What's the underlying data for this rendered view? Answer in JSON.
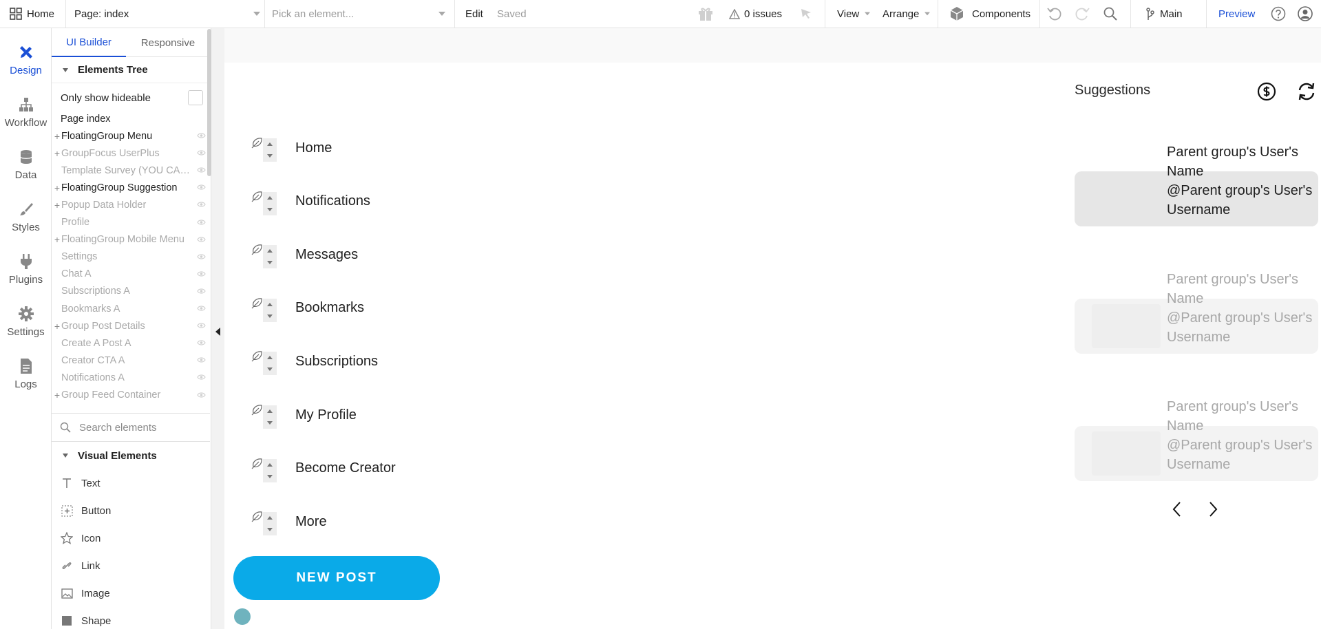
{
  "topbar": {
    "home_label": "Home",
    "page_label": "Page: index",
    "element_placeholder": "Pick an element...",
    "edit_label": "Edit",
    "saved_label": "Saved",
    "issues_label": "0 issues",
    "view_label": "View",
    "arrange_label": "Arrange",
    "components_label": "Components",
    "branch_label": "Main",
    "preview_label": "Preview"
  },
  "rail": {
    "items": [
      {
        "label": "Design",
        "icon": "design-icon"
      },
      {
        "label": "Workflow",
        "icon": "workflow-icon"
      },
      {
        "label": "Data",
        "icon": "database-icon"
      },
      {
        "label": "Styles",
        "icon": "brush-icon"
      },
      {
        "label": "Plugins",
        "icon": "plug-icon"
      },
      {
        "label": "Settings",
        "icon": "gear-icon"
      },
      {
        "label": "Logs",
        "icon": "document-icon"
      }
    ]
  },
  "panel": {
    "tabs": [
      "UI Builder",
      "Responsive"
    ],
    "tree_title": "Elements Tree",
    "only_hideable_label": "Only show hideable",
    "page_row": "Page index",
    "tree_items": [
      {
        "label": "FloatingGroup Menu",
        "plus": "+",
        "dim": false
      },
      {
        "label": "GroupFocus UserPlus",
        "plus": "+",
        "dim": true
      },
      {
        "label": "Template Survey (YOU CAN...",
        "plus": "",
        "dim": true
      },
      {
        "label": "FloatingGroup Suggestion",
        "plus": "+",
        "dim": false
      },
      {
        "label": "Popup Data Holder",
        "plus": "+",
        "dim": true
      },
      {
        "label": "Profile",
        "plus": "",
        "dim": true
      },
      {
        "label": "FloatingGroup Mobile Menu",
        "plus": "+",
        "dim": true
      },
      {
        "label": "Settings",
        "plus": "",
        "dim": true
      },
      {
        "label": "Chat A",
        "plus": "",
        "dim": true
      },
      {
        "label": "Subscriptions A",
        "plus": "",
        "dim": true
      },
      {
        "label": "Bookmarks A",
        "plus": "",
        "dim": true
      },
      {
        "label": "Group Post Details",
        "plus": "+",
        "dim": true
      },
      {
        "label": "Create A Post A",
        "plus": "",
        "dim": true
      },
      {
        "label": "Creator CTA A",
        "plus": "",
        "dim": true
      },
      {
        "label": "Notifications A",
        "plus": "",
        "dim": true
      },
      {
        "label": "Group Feed Container",
        "plus": "+",
        "dim": true
      }
    ],
    "search_placeholder": "Search elements",
    "visual_title": "Visual Elements",
    "visual_items": [
      {
        "label": "Text",
        "icon": "text-icon"
      },
      {
        "label": "Button",
        "icon": "button-icon"
      },
      {
        "label": "Icon",
        "icon": "star-icon"
      },
      {
        "label": "Link",
        "icon": "link-icon"
      },
      {
        "label": "Image",
        "icon": "image-icon"
      },
      {
        "label": "Shape",
        "icon": "shape-icon"
      }
    ]
  },
  "canvas": {
    "nav_items": [
      "Home",
      "Notifications",
      "Messages",
      "Bookmarks",
      "Subscriptions",
      "My Profile",
      "Become Creator",
      "More"
    ],
    "new_post_label": "NEW POST",
    "suggestions_title": "Suggestions",
    "suggestions": [
      {
        "name": "Parent group's User's Name",
        "username": "@Parent group's User's Username"
      },
      {
        "name": "Parent group's User's Name",
        "username": "@Parent group's User's Username"
      },
      {
        "name": "Parent group's User's Name",
        "username": "@Parent group's User's Username"
      }
    ]
  },
  "colors": {
    "accent": "#1a4fd6",
    "new_post_bg": "#0aaae8"
  }
}
